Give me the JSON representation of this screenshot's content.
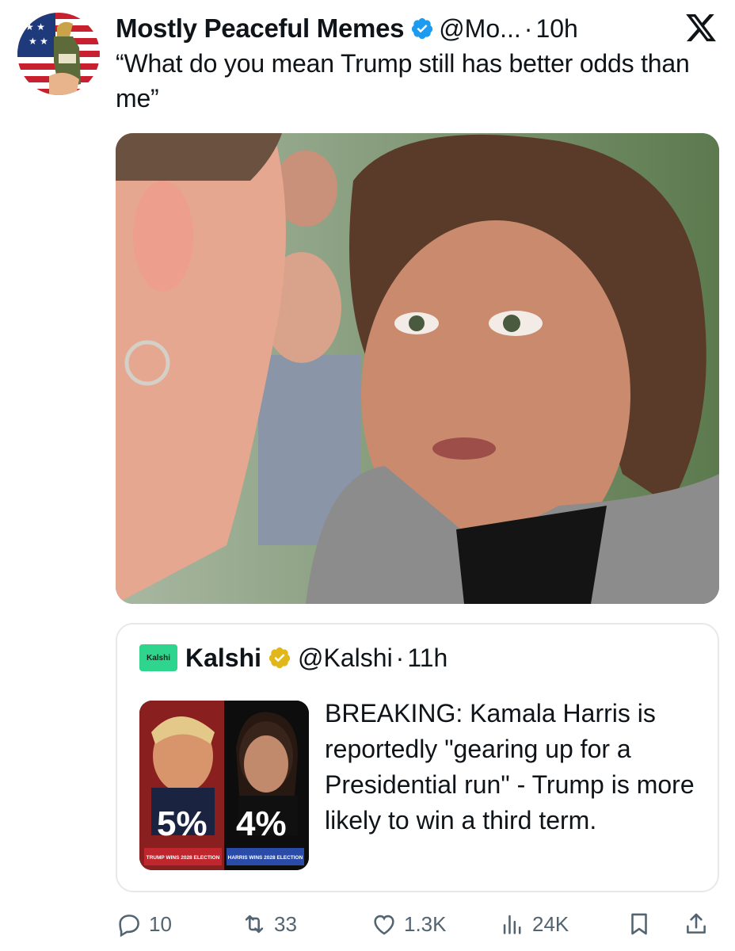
{
  "tweet": {
    "author_name": "Mostly Peaceful Memes",
    "handle": "@Mo...",
    "separator": "·",
    "time": "10h",
    "text": "“What do you mean Trump still has better odds than me”"
  },
  "quoted": {
    "logo_text": "Kalshi",
    "author_name": "Kalshi",
    "handle": "@Kalshi",
    "separator": "·",
    "time": "11h",
    "text": "BREAKING: Kamala Harris is reportedly \"gearing up for a Presidential run\" - Trump is more likely to win a third term.",
    "thumb": {
      "left_pct": "5%",
      "right_pct": "4%",
      "left_caption": "TRUMP WINS 2028 ELECTION",
      "right_caption": "HARRIS WINS 2028 ELECTION"
    }
  },
  "actions": {
    "replies": "10",
    "reposts": "33",
    "likes": "1.3K",
    "views": "24K"
  },
  "colors": {
    "verified_blue": "#1d9bf0",
    "verified_gold": "#e2b719",
    "kalshi_green": "#2fd58c",
    "muted": "#536471"
  },
  "icons": [
    "x-logo-icon",
    "verified-badge-icon",
    "gold-verified-badge-icon",
    "reply-icon",
    "repost-icon",
    "like-icon",
    "views-icon",
    "bookmark-icon",
    "share-icon"
  ]
}
